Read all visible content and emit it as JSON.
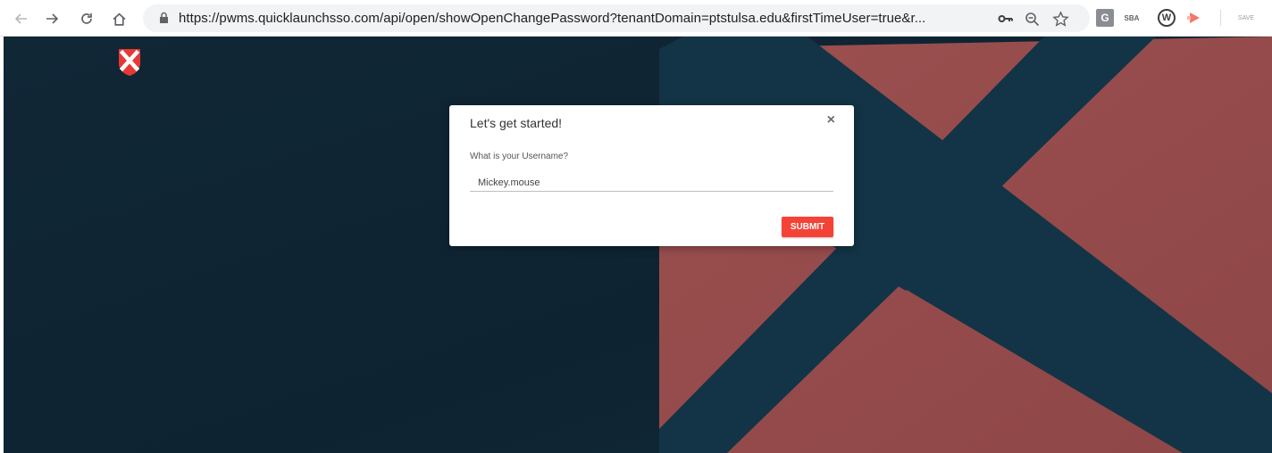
{
  "browser": {
    "url": "https://pwms.quicklaunchsso.com/api/open/showOpenChangePassword?tenantDomain=ptstulsa.edu&firstTimeUser=true&r...",
    "nav_icons": {
      "back": "arrow-left-icon",
      "forward": "arrow-right-icon",
      "reload": "reload-icon",
      "home": "home-icon",
      "lock": "lock-icon"
    },
    "omnibox_icons": [
      "key-icon",
      "zoom-icon",
      "star-icon"
    ],
    "extensions": {
      "g_label": "G",
      "small_ext_label": "SBA",
      "w_label": "W",
      "last_ext_label": "SAVE"
    }
  },
  "page": {
    "colors": {
      "background": "#0f2534",
      "accent_red": "#9a4f4f",
      "band_blue": "#14374c"
    },
    "logo_icon": "quicklaunch-shield-x-logo"
  },
  "modal": {
    "title": "Let's get started!",
    "close_label": "×",
    "field_label": "What is your Username?",
    "username_value": "Mickey.mouse",
    "submit_label": "SUBMIT",
    "submit_color": "#f44336"
  }
}
